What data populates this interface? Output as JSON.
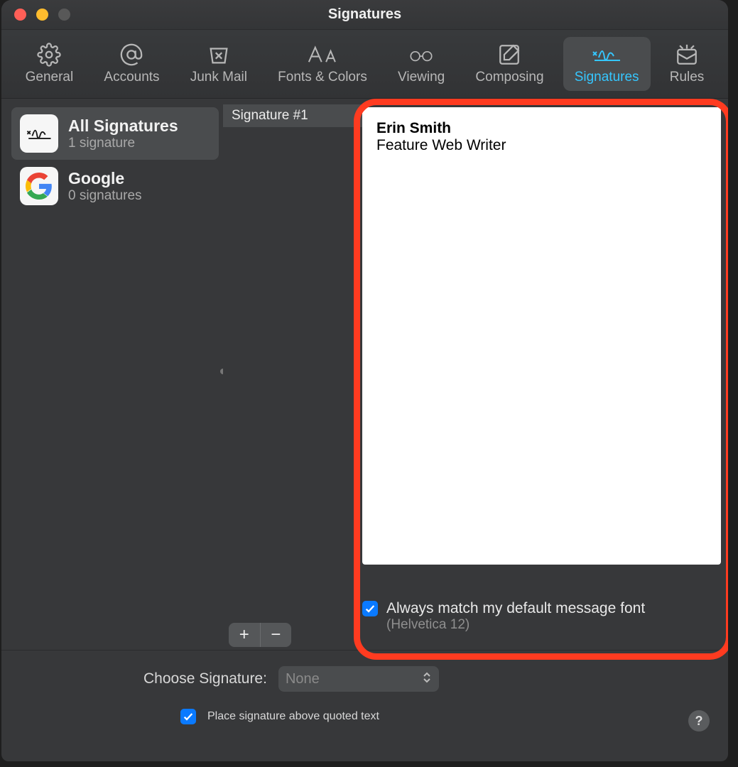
{
  "window": {
    "title": "Signatures"
  },
  "toolbar": {
    "items": [
      {
        "label": "General"
      },
      {
        "label": "Accounts"
      },
      {
        "label": "Junk Mail"
      },
      {
        "label": "Fonts & Colors"
      },
      {
        "label": "Viewing"
      },
      {
        "label": "Composing"
      },
      {
        "label": "Signatures"
      },
      {
        "label": "Rules"
      }
    ]
  },
  "accounts": [
    {
      "title": "All Signatures",
      "subtitle": "1 signature"
    },
    {
      "title": "Google",
      "subtitle": "0 signatures"
    }
  ],
  "signatures": [
    {
      "name": "Signature #1"
    }
  ],
  "editor": {
    "line1": "Erin Smith",
    "line2": "Feature Web Writer"
  },
  "options": {
    "match_font_label": "Always match my default message font",
    "font_hint": "(Helvetica 12)"
  },
  "choose": {
    "label": "Choose Signature:",
    "value": "None"
  },
  "place_above": {
    "label": "Place signature above quoted text"
  },
  "buttons": {
    "plus": "+",
    "minus": "−",
    "help": "?"
  }
}
